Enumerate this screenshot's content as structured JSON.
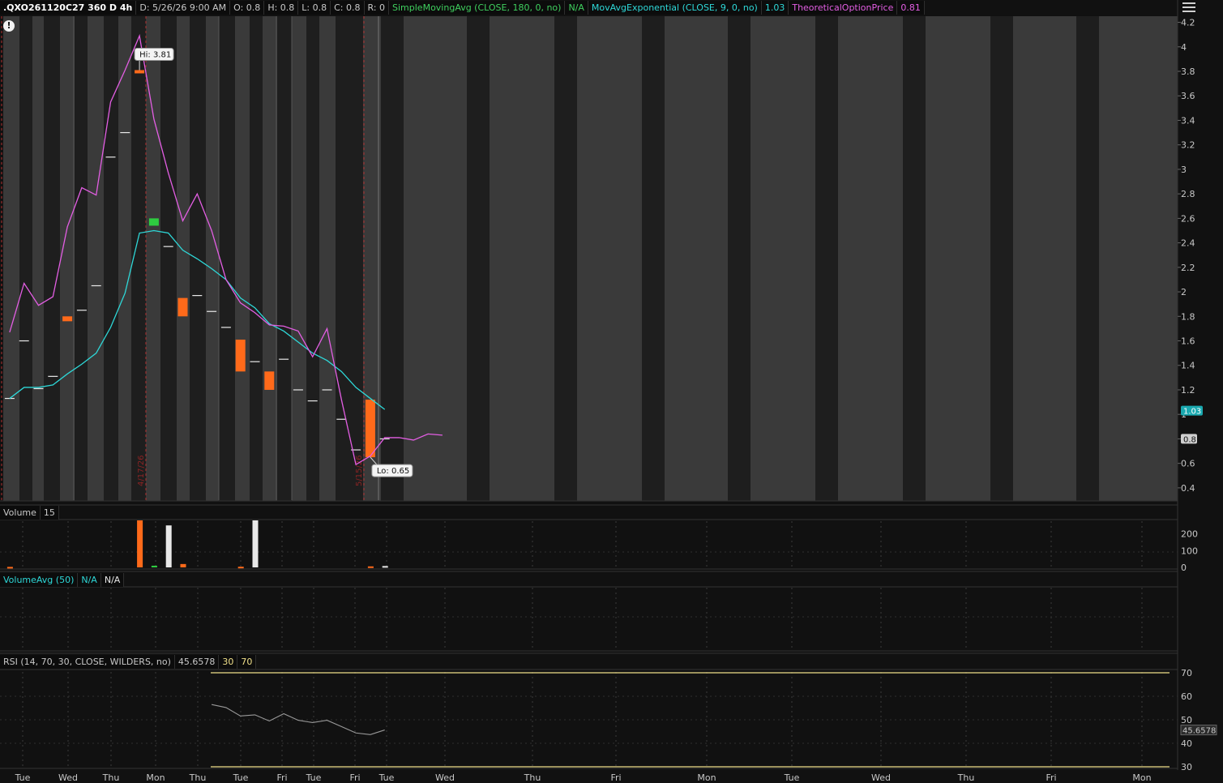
{
  "header": {
    "symbol": ".QXO261120C27 360 D 4h",
    "date": "D: 5/26/26 9:00 AM",
    "open": "O: 0.8",
    "high": "H: 0.8",
    "low": "L: 0.8",
    "close": "C: 0.8",
    "range": "R: 0",
    "sma_label": "SimpleMovingAvg (CLOSE, 180, 0, no)",
    "sma_value": "N/A",
    "ema_label": "MovAvgExponential (CLOSE, 9, 0, no)",
    "ema_value": "1.03",
    "top_label": "TheoreticalOptionPrice",
    "top_value": "0.81"
  },
  "icons": {
    "menu": "menu-icon",
    "alert": "alert-icon"
  },
  "alert_glyph": "!",
  "volume_panel": {
    "label": "Volume",
    "value": "15"
  },
  "volavg_panel": {
    "label": "VolumeAvg (50)",
    "value1": "N/A",
    "value2": "N/A"
  },
  "rsi_panel": {
    "label": "RSI (14, 70, 30, CLOSE, WILDERS, no)",
    "value": "45.6578",
    "ob": "30",
    "os": "70"
  },
  "colors": {
    "background": "#111111",
    "session_light": "#3a3a3a",
    "session_dark": "#1e1e1e",
    "up_candle": "#2ecc40",
    "down_candle": "#ff6a1a",
    "flat_bar": "#e8e8e8",
    "ema": "#2ed8d8",
    "theoretical": "#e35ee3",
    "rsi": "#9a9a9a",
    "rsi_bands": "#f0e08a"
  },
  "chart_data": [
    {
      "type": "candlestick",
      "title": ".QXO261120C27 360 D 4h",
      "x_tick_labels": [
        "Tue",
        "Wed",
        "Thu",
        "Mon",
        "Thu",
        "Tue",
        "Fri",
        "Tue",
        "Fri",
        "Tue",
        "Wed",
        "Thu",
        "Fri",
        "Mon",
        "Tue",
        "Wed",
        "Thu",
        "Fri",
        "Mon"
      ],
      "y_ticks": [
        0.4,
        0.6,
        0.8,
        1,
        1.2,
        1.4,
        1.6,
        1.8,
        2,
        2.2,
        2.4,
        2.6,
        2.8,
        3,
        3.2,
        3.4,
        3.6,
        3.8,
        4,
        4.2
      ],
      "ylim": [
        0.3,
        4.25
      ],
      "date_markers": [
        "4/17/26",
        "5/15/26"
      ],
      "bars": [
        {
          "x": 1,
          "open": 1.13,
          "high": 1.13,
          "low": 1.13,
          "close": 1.13
        },
        {
          "x": 3,
          "open": 1.6,
          "high": 1.6,
          "low": 1.6,
          "close": 1.6
        },
        {
          "x": 5,
          "open": 1.21,
          "high": 1.21,
          "low": 1.21,
          "close": 1.21
        },
        {
          "x": 7,
          "open": 1.31,
          "high": 1.31,
          "low": 1.31,
          "close": 1.31
        },
        {
          "x": 9,
          "open": 1.8,
          "high": 1.8,
          "low": 1.76,
          "close": 1.76
        },
        {
          "x": 11,
          "open": 1.85,
          "high": 1.85,
          "low": 1.85,
          "close": 1.85
        },
        {
          "x": 13,
          "open": 2.05,
          "high": 2.05,
          "low": 2.05,
          "close": 2.05
        },
        {
          "x": 15,
          "open": 3.1,
          "high": 3.1,
          "low": 3.1,
          "close": 3.1
        },
        {
          "x": 17,
          "open": 3.3,
          "high": 3.3,
          "low": 3.3,
          "close": 3.3
        },
        {
          "x": 19,
          "open": 3.81,
          "high": 3.81,
          "low": 3.79,
          "close": 3.79
        },
        {
          "x": 21,
          "open": 2.54,
          "high": 2.6,
          "low": 2.5,
          "close": 2.6
        },
        {
          "x": 23,
          "open": 2.37,
          "high": 2.37,
          "low": 2.37,
          "close": 2.37
        },
        {
          "x": 25,
          "open": 1.95,
          "high": 1.95,
          "low": 1.8,
          "close": 1.8
        },
        {
          "x": 27,
          "open": 1.97,
          "high": 1.97,
          "low": 1.97,
          "close": 1.97
        },
        {
          "x": 29,
          "open": 1.84,
          "high": 1.84,
          "low": 1.84,
          "close": 1.84
        },
        {
          "x": 31,
          "open": 1.71,
          "high": 1.71,
          "low": 1.71,
          "close": 1.71
        },
        {
          "x": 33,
          "open": 1.61,
          "high": 1.61,
          "low": 1.35,
          "close": 1.35
        },
        {
          "x": 35,
          "open": 1.43,
          "high": 1.43,
          "low": 1.43,
          "close": 1.43
        },
        {
          "x": 37,
          "open": 1.35,
          "high": 1.35,
          "low": 1.2,
          "close": 1.2
        },
        {
          "x": 39,
          "open": 1.45,
          "high": 1.45,
          "low": 1.45,
          "close": 1.45
        },
        {
          "x": 41,
          "open": 1.2,
          "high": 1.2,
          "low": 1.2,
          "close": 1.2
        },
        {
          "x": 43,
          "open": 1.11,
          "high": 1.11,
          "low": 1.11,
          "close": 1.11
        },
        {
          "x": 45,
          "open": 1.2,
          "high": 1.2,
          "low": 1.2,
          "close": 1.2
        },
        {
          "x": 47,
          "open": 0.96,
          "high": 0.96,
          "low": 0.96,
          "close": 0.96
        },
        {
          "x": 49,
          "open": 0.71,
          "high": 0.71,
          "low": 0.71,
          "close": 0.71
        },
        {
          "x": 51,
          "open": 1.12,
          "high": 1.12,
          "low": 0.65,
          "close": 0.65
        },
        {
          "x": 53,
          "open": 0.8,
          "high": 0.8,
          "low": 0.8,
          "close": 0.8
        }
      ],
      "series": [
        {
          "name": "MovAvgExponential (CLOSE, 9, 0, no)",
          "x": [
            1,
            3,
            5,
            7,
            9,
            11,
            13,
            15,
            17,
            19,
            21,
            23,
            25,
            27,
            29,
            31,
            33,
            35,
            37,
            39,
            41,
            43,
            45,
            47,
            49,
            51,
            53
          ],
          "values": [
            1.13,
            1.22,
            1.22,
            1.24,
            1.33,
            1.41,
            1.5,
            1.71,
            1.99,
            2.48,
            2.5,
            2.48,
            2.34,
            2.27,
            2.19,
            2.1,
            1.95,
            1.87,
            1.74,
            1.68,
            1.59,
            1.5,
            1.44,
            1.35,
            1.22,
            1.13,
            1.04
          ]
        },
        {
          "name": "TheoreticalOptionPrice",
          "x": [
            1,
            3,
            5,
            7,
            9,
            11,
            13,
            15,
            17,
            19,
            21,
            23,
            25,
            27,
            29,
            31,
            33,
            35,
            37,
            39,
            41,
            43,
            45,
            47,
            49,
            51,
            53,
            55,
            57,
            59,
            61
          ],
          "values": [
            1.67,
            2.07,
            1.89,
            1.96,
            2.53,
            2.85,
            2.79,
            3.55,
            3.81,
            4.09,
            3.41,
            2.97,
            2.58,
            2.8,
            2.5,
            2.1,
            1.91,
            1.83,
            1.73,
            1.72,
            1.68,
            1.47,
            1.7,
            1.12,
            0.59,
            0.66,
            0.81,
            0.81,
            0.79,
            0.84,
            0.83
          ]
        }
      ],
      "annotations": [
        {
          "text": "Hi: 3.81",
          "x": 19,
          "y": 3.81
        },
        {
          "text": "Lo: 0.65",
          "x": 51,
          "y": 0.65
        }
      ],
      "last_value_labels": [
        {
          "text": "1.03",
          "y": 1.03,
          "color": "#2ed8d8"
        },
        {
          "text": "0.8",
          "y": 0.8,
          "color": "#d8d8d8"
        }
      ]
    },
    {
      "type": "bar",
      "title": "Volume",
      "y_ticks": [
        0,
        100,
        200
      ],
      "ylim": [
        0,
        280
      ],
      "bars": [
        {
          "x": 1,
          "value": 3,
          "dir": "down"
        },
        {
          "x": 19,
          "value": 280,
          "dir": "down"
        },
        {
          "x": 21,
          "value": 10,
          "dir": "up"
        },
        {
          "x": 23,
          "value": 250,
          "dir": "flat"
        },
        {
          "x": 25,
          "value": 20,
          "dir": "down"
        },
        {
          "x": 33,
          "value": 4,
          "dir": "down"
        },
        {
          "x": 35,
          "value": 280,
          "dir": "flat"
        },
        {
          "x": 51,
          "value": 6,
          "dir": "down"
        },
        {
          "x": 53,
          "value": 8,
          "dir": "flat"
        }
      ]
    },
    {
      "type": "line",
      "title": "RSI (14, 70, 30, CLOSE, WILDERS, no)",
      "y_ticks": [
        30,
        40,
        50,
        60,
        70
      ],
      "ylim": [
        30,
        70
      ],
      "bands": [
        30,
        70
      ],
      "series": [
        {
          "name": "RSI",
          "x": [
            29,
            31,
            33,
            35,
            37,
            39,
            41,
            43,
            45,
            47,
            49,
            51,
            53
          ],
          "values": [
            56.5,
            55.2,
            51.6,
            52.1,
            49.5,
            52.6,
            49.8,
            48.8,
            49.8,
            47.1,
            44.4,
            43.7,
            45.66
          ]
        }
      ],
      "last_value_label": "45.6578"
    }
  ]
}
